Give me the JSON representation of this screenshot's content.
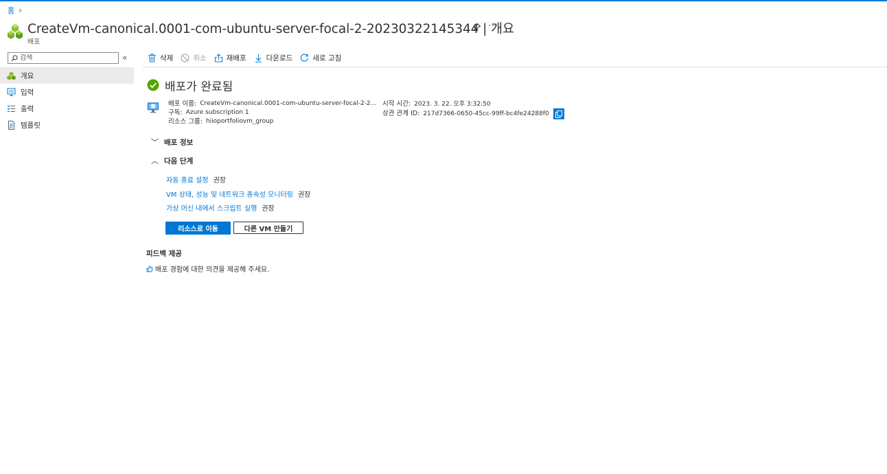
{
  "breadcrumb": {
    "home": "홈"
  },
  "header": {
    "title": "CreateVm-canonical.0001-com-ubuntu-server-focal-2-20230322145344 | 개요",
    "subtitle": "배포",
    "more": "···"
  },
  "sidebar": {
    "search_placeholder": "검색",
    "collapse": "«",
    "items": [
      {
        "label": "개요",
        "icon": "deployment-icon",
        "active": true
      },
      {
        "label": "입력",
        "icon": "input-icon",
        "active": false
      },
      {
        "label": "출력",
        "icon": "output-icon",
        "active": false
      },
      {
        "label": "템플릿",
        "icon": "template-icon",
        "active": false
      }
    ]
  },
  "toolbar": {
    "delete": "삭제",
    "cancel": "취소",
    "redeploy": "재배포",
    "download": "다운로드",
    "refresh": "새로 고침"
  },
  "status": {
    "text": "배포가 완료됨"
  },
  "details": {
    "name_label": "배포 이름:",
    "name_value": "CreateVm-canonical.0001-com-ubuntu-server-focal-2-2...",
    "subscription_label": "구독:",
    "subscription_value": "Azure subscription 1",
    "rg_label": "리소스 그룹:",
    "rg_value": "hiioportfoliovm_group",
    "start_label": "시작 시간:",
    "start_value": "2023. 3. 22. 오후 3:32:50",
    "corr_label": "상관 관계 ID:",
    "corr_value": "217d7366-0650-45cc-99ff-bc4fe24288f0"
  },
  "sections": {
    "deployment_details": "배포 정보",
    "next_steps": "다음 단계",
    "collapsed_chevron": "﹀",
    "expanded_chevron": "︿"
  },
  "next_steps": {
    "items": [
      {
        "label": "자동 종료 설정",
        "tag": "권장"
      },
      {
        "label": "VM 상태, 성능 및 네트워크 종속성 모니터링",
        "tag": "권장"
      },
      {
        "label": "가상 머신 내에서 스크립트 실행",
        "tag": "권장"
      }
    ]
  },
  "buttons": {
    "go_to_resource": "리소스로 이동",
    "create_another_vm": "다른 VM 만들기"
  },
  "feedback": {
    "title": "피드백 제공",
    "link": "배포 경험에 대한 의견을 제공해 주세요."
  },
  "colors": {
    "accent": "#0078d4",
    "success": "#57a300",
    "nav_active_bg": "#edebe9"
  }
}
